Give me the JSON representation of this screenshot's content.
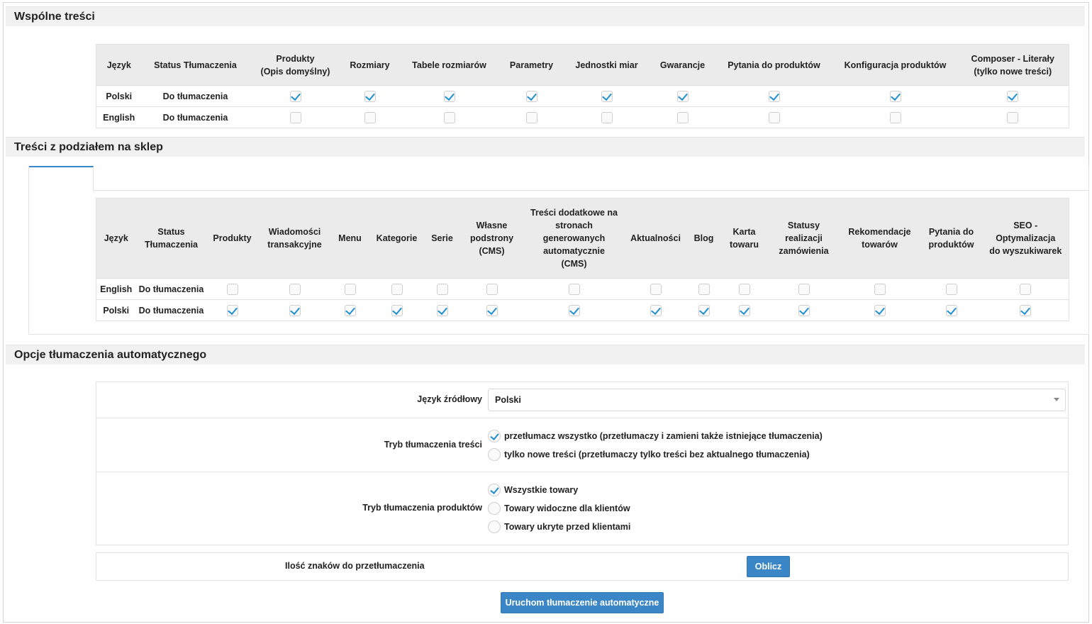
{
  "sections": {
    "common": "Wspólne treści",
    "shop": "Treści z podziałem na sklep",
    "auto": "Opcje tłumaczenia automatycznego"
  },
  "common_table": {
    "headers": [
      "Język",
      "Status Tłumaczenia",
      "Produkty\n(Opis domyślny)",
      "Rozmiary",
      "Tabele rozmiarów",
      "Parametry",
      "Jednostki miar",
      "Gwarancje",
      "Pytania do produktów",
      "Konfiguracja produktów",
      "Composer - Literały\n(tylko nowe treści)"
    ],
    "rows": [
      {
        "lang": "Polski",
        "status": "Do tłumaczenia",
        "checked": true
      },
      {
        "lang": "English",
        "status": "Do tłumaczenia",
        "checked": false
      }
    ]
  },
  "shop_table": {
    "headers": [
      "Język",
      "Status\nTłumaczenia",
      "Produkty",
      "Wiadomości\ntransakcyjne",
      "Menu",
      "Kategorie",
      "Serie",
      "Własne\npodstrony\n(CMS)",
      "Treści dodatkowe na\nstronach\ngenerowanych\nautomatycznie\n(CMS)",
      "Aktualności",
      "Blog",
      "Karta\ntowaru",
      "Statusy\nrealizacji\nzamówienia",
      "Rekomendacje\ntowarów",
      "Pytania do\nproduktów",
      "SEO -\nOptymalizacja\ndo wyszukiwarek"
    ],
    "rows": [
      {
        "lang": "English",
        "status": "Do tłumaczenia",
        "checked": false
      },
      {
        "lang": "Polski",
        "status": "Do tłumaczenia",
        "checked": true
      }
    ]
  },
  "auto_options": {
    "source_lang_label": "Język źródłowy",
    "source_lang_value": "Polski",
    "content_mode_label": "Tryb tłumaczenia treści",
    "content_mode_options": [
      {
        "label": "przetłumacz wszystko (przetłumaczy i zamieni także istniejące tłumaczenia)",
        "checked": true
      },
      {
        "label": "tylko nowe treści (przetłumaczy tylko treści bez aktualnego tłumaczenia)",
        "checked": false
      }
    ],
    "product_mode_label": "Tryb tłumaczenia produktów",
    "product_mode_options": [
      {
        "label": "Wszystkie towary",
        "checked": true
      },
      {
        "label": "Towary widoczne dla klientów",
        "checked": false
      },
      {
        "label": "Towary ukryte przed klientami",
        "checked": false
      }
    ],
    "char_count_label": "Ilość znaków do przetłumaczenia",
    "calc_button": "Oblicz",
    "run_button": "Uruchom tłumaczenie automatyczne"
  }
}
